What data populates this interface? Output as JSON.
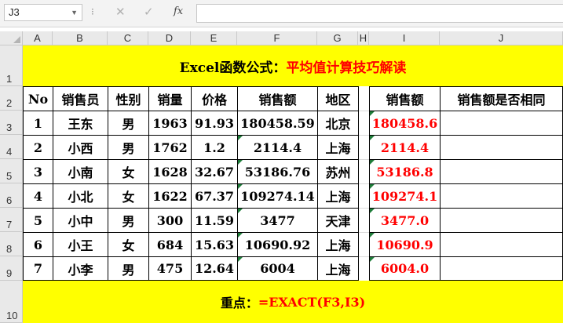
{
  "formula_bar": {
    "name_box": "J3",
    "cancel_icon": "✕",
    "confirm_icon": "✓",
    "fx_label": "fx",
    "formula": ""
  },
  "columns": [
    "A",
    "B",
    "C",
    "D",
    "E",
    "F",
    "G",
    "H",
    "I",
    "J"
  ],
  "rows": [
    "1",
    "2",
    "3",
    "4",
    "5",
    "6",
    "7",
    "8",
    "9",
    "10"
  ],
  "title": {
    "black": "Excel函数公式：",
    "red": "平均值计算技巧解读"
  },
  "headers": [
    "No",
    "销售员",
    "性别",
    "销量",
    "价格",
    "销售额",
    "地区"
  ],
  "headers_right": [
    "销售额",
    "销售额是否相同"
  ],
  "data": [
    [
      "1",
      "王东",
      "男",
      "1963",
      "91.93",
      "180458.59",
      "北京",
      "180458.6",
      ""
    ],
    [
      "2",
      "小西",
      "男",
      "1762",
      "1.2",
      "2114.4",
      "上海",
      "2114.4",
      ""
    ],
    [
      "3",
      "小南",
      "女",
      "1628",
      "32.67",
      "53186.76",
      "苏州",
      "53186.8",
      ""
    ],
    [
      "4",
      "小北",
      "女",
      "1622",
      "67.37",
      "109274.14",
      "上海",
      "109274.1",
      ""
    ],
    [
      "5",
      "小中",
      "男",
      "300",
      "11.59",
      "3477",
      "天津",
      "3477.0",
      ""
    ],
    [
      "6",
      "小王",
      "女",
      "684",
      "15.63",
      "10690.92",
      "上海",
      "10690.9",
      ""
    ],
    [
      "7",
      "小李",
      "男",
      "475",
      "12.64",
      "6004",
      "上海",
      "6004.0",
      ""
    ]
  ],
  "footer": {
    "black": "重点：",
    "red": "=EXACT(F3,I3)"
  },
  "colors": {
    "highlight": "#ffff00",
    "accent_red": "#ff0000",
    "indicator_green": "#1e7d3a"
  }
}
